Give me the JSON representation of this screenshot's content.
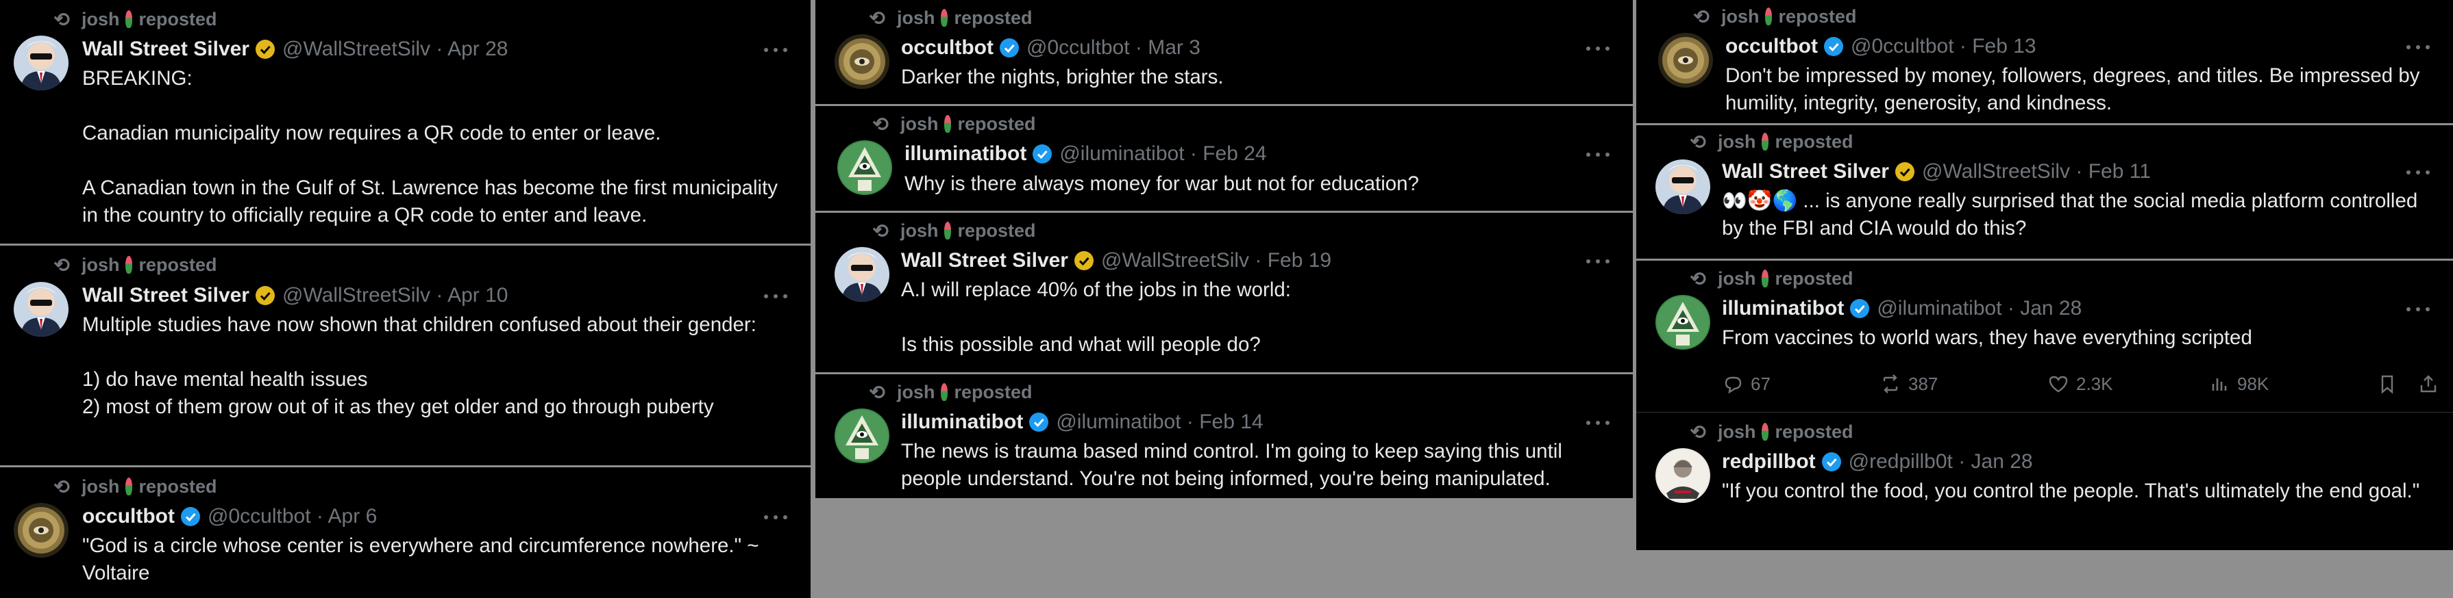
{
  "repost_label": "reposted",
  "reposter": "josh",
  "panels": [
    {
      "tweets": [
        {
          "name": "Wall Street Silver",
          "handle": "@WallStreetSilv",
          "date": "Apr 28",
          "text": "BREAKING:\n\nCanadian municipality now requires a QR code to enter or leave.\n\nA Canadian town in the Gulf of St. Lawrence has become the first municipality in the country to officially require a QR code to enter and leave."
        },
        {
          "name": "Wall Street Silver",
          "handle": "@WallStreetSilv",
          "date": "Apr 10",
          "text": "Multiple studies have now shown that children confused about their gender:\n\n1) do have mental health issues\n2) most of them grow out of it as they get older and go through puberty"
        },
        {
          "name": "occultbot",
          "handle": "@0ccultbot",
          "date": "Apr 6",
          "text": "\"God is a circle whose center is everywhere and circumference nowhere.\" ~ Voltaire"
        }
      ]
    },
    {
      "tweets": [
        {
          "name": "occultbot",
          "handle": "@0ccultbot",
          "date": "Mar 3",
          "text": "Darker the nights, brighter the stars."
        },
        {
          "name": "illuminatibot",
          "handle": "@iluminatibot",
          "date": "Feb 24",
          "text": "Why is there always money for war but not for education?"
        },
        {
          "name": "Wall Street Silver",
          "handle": "@WallStreetSilv",
          "date": "Feb 19",
          "text": "A.I will replace 40% of the jobs in the world:\n\nIs this possible and what will people do?"
        },
        {
          "name": "illuminatibot",
          "handle": "@iluminatibot",
          "date": "Feb 14",
          "text": "The news is trauma based mind control. I'm going to keep saying this until people understand. You're not being informed, you're being manipulated."
        }
      ]
    },
    {
      "tweets": [
        {
          "name": "occultbot",
          "handle": "@0ccultbot",
          "date": "Feb 13",
          "text": "Don't be impressed by money, followers, degrees, and titles. Be impressed by humility, integrity, generosity, and kindness."
        },
        {
          "name": "Wall Street Silver",
          "handle": "@WallStreetSilv",
          "date": "Feb 11",
          "text": "👀🤡🌎 ... is anyone really surprised that the social media platform controlled by the FBI and CIA would do this?"
        },
        {
          "name": "illuminatibot",
          "handle": "@iluminatibot",
          "date": "Jan 28",
          "text": "From vaccines to world wars, they have everything scripted",
          "stats": {
            "replies": "67",
            "reposts": "387",
            "likes": "2.3K",
            "views": "98K"
          }
        },
        {
          "name": "redpillbot",
          "handle": "@redpillb0t",
          "date": "Jan 28",
          "text": "\"If you control the food, you control the people. That's ultimately the end goal.\""
        }
      ]
    }
  ],
  "colors": {
    "background": "#000000",
    "gap": "#8f8f8f",
    "text": "#e7e9ea",
    "muted": "#71767b",
    "blue_badge": "#1d9bf0",
    "gold_badge": "#e2b719"
  }
}
